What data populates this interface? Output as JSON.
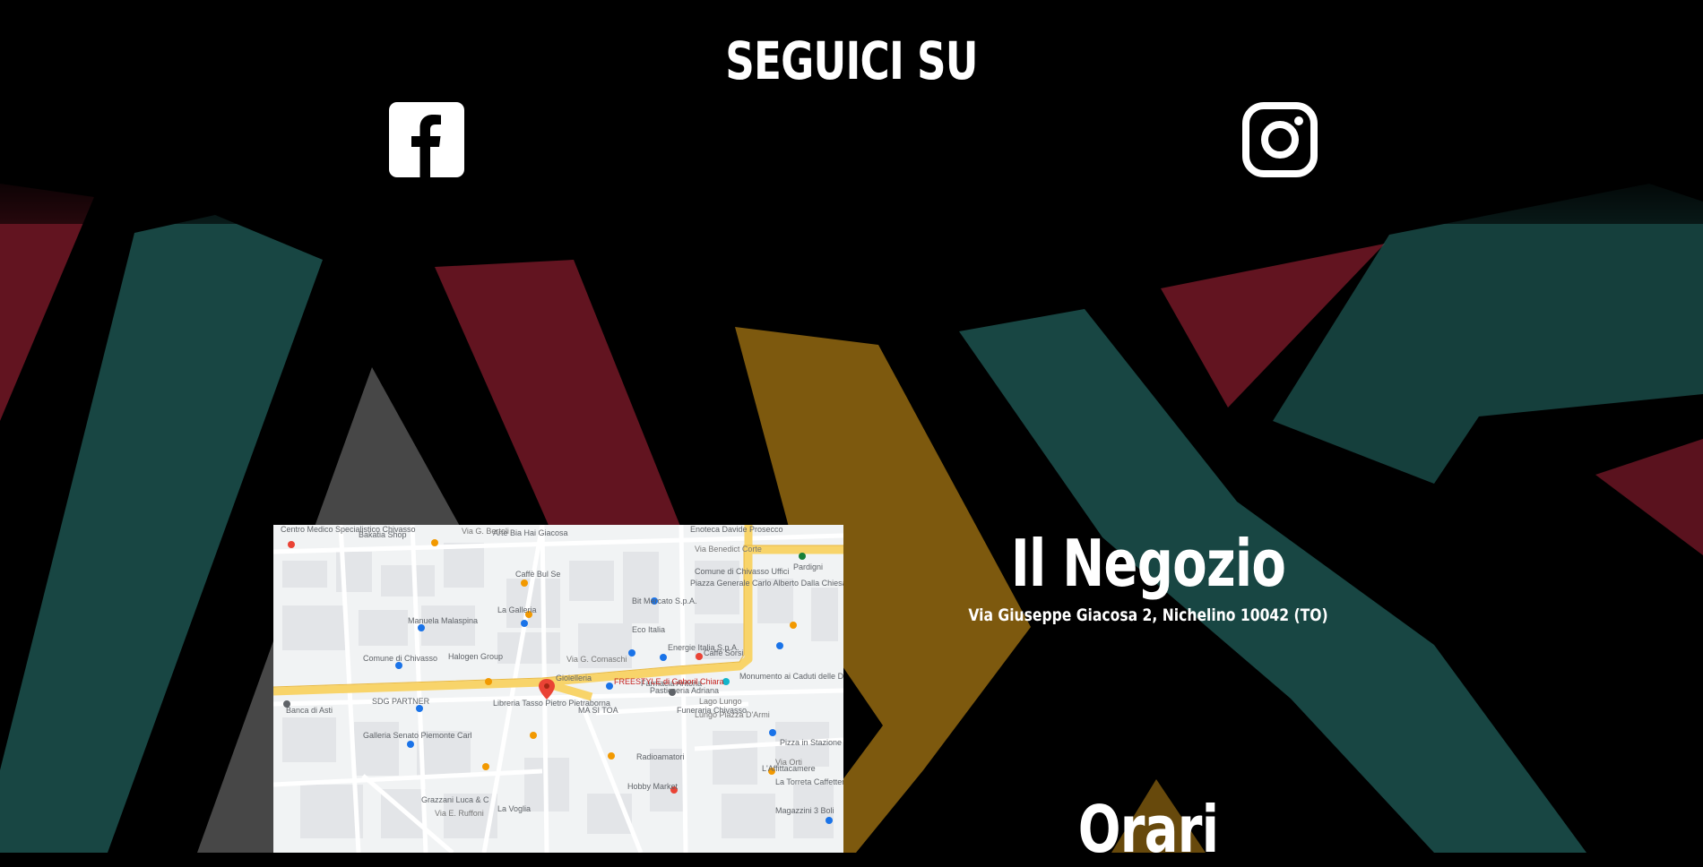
{
  "social": {
    "title": "SEGUICI SU",
    "facebook_icon": "facebook-icon",
    "instagram_icon": "instagram-icon"
  },
  "shop": {
    "title": "Il Negozio",
    "address": "Via Giuseppe Giacosa 2, Nichelino 10042 (TO)"
  },
  "hours": {
    "title": "Orari"
  },
  "map": {
    "labels": [
      "Centro Medico Specialistico Chivasso",
      "Bakatia Shop",
      "Arte Bia Hai Giacosa",
      "Enoteca Davide Prosecco",
      "Via G. Bertoli",
      "Via Benedict Corte",
      "Caffè Bul Se",
      "Bit Mercato S.p.A.",
      "Comune di Chivasso Uffici",
      "Pardigni",
      "Manuela Malaspina",
      "La Galleria",
      "Piazza Generale Carlo Alberto Dalla Chiesa",
      "Eco Italia",
      "Comune di Chivasso",
      "Halogen Group",
      "Energie Italia S.p.A.",
      "Caffè Sorsi",
      "Farmacia Antona",
      "Pasticceria Adriana",
      "Gioielleria",
      "FREESTYLE di Gaboril Chiara",
      "Lago Lungo",
      "Monumento ai Caduti delle Due Guerre",
      "Funeraria Chivasso",
      "SDG PARTNER",
      "Libreria Tasso Pietro Pietraborna",
      "Lungo Piazza D'Armi",
      "Banca di Asti",
      "MA SI TOA",
      "Pizza in Stazione",
      "Via Orti",
      "Galleria Senato Piemonte Carl",
      "Radioamatori",
      "La Torreta Caffetteria",
      "Hobby Market",
      "L'Affittacamere",
      "La Voglia",
      "Magazzini 3 Boli",
      "Grazzani Luca & C",
      "Via E. Ruffoni",
      "Via G. Comaschi"
    ]
  },
  "colors": {
    "background": "#000000",
    "teal": "#2f8b86",
    "red": "#b3243b",
    "yellow": "#e4a21a",
    "grey": "#9d9d9d",
    "text": "#ffffff",
    "map_road_major": "#f8d46a",
    "map_pin": "#ea4335"
  }
}
